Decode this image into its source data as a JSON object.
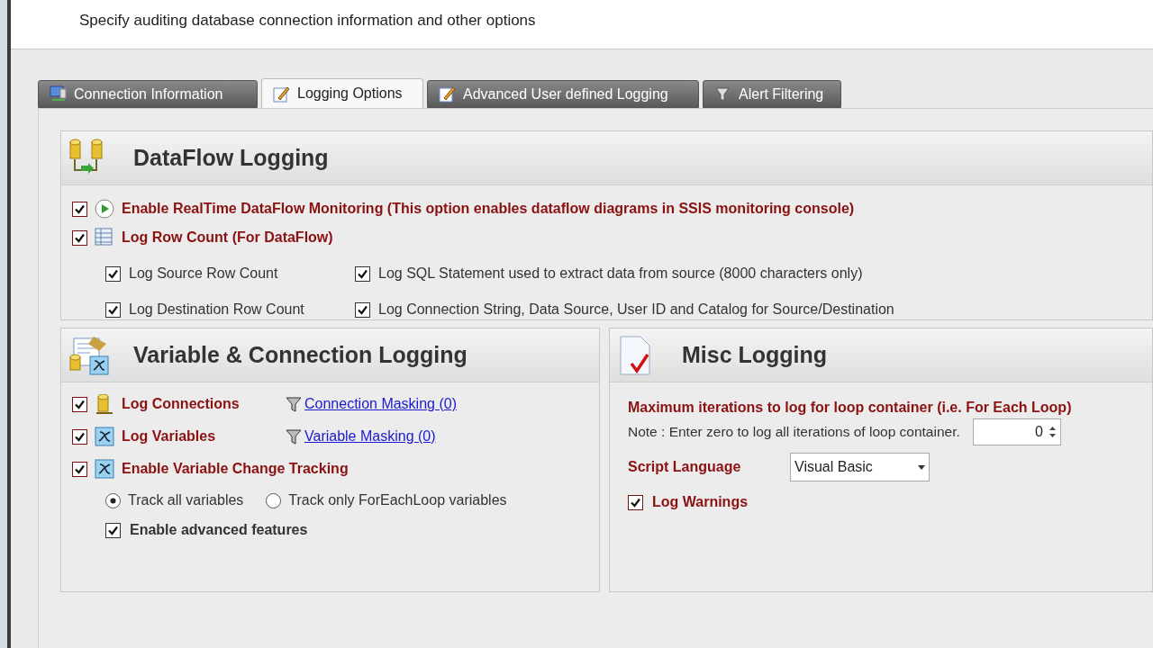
{
  "header": {
    "subtitle": "Specify auditing database connection information and other options"
  },
  "tabs": [
    {
      "label": "Connection Information",
      "selected": false
    },
    {
      "label": "Logging Options",
      "selected": true
    },
    {
      "label": "Advanced User defined Logging",
      "selected": false
    },
    {
      "label": "Alert Filtering",
      "selected": false
    }
  ],
  "dataflow": {
    "title": "DataFlow Logging",
    "options": [
      {
        "label": "Enable RealTime DataFlow Monitoring (This option enables dataflow diagrams in SSIS monitoring console)",
        "checked": true
      },
      {
        "label": "Log Row Count (For DataFlow)",
        "checked": true
      }
    ],
    "sub_options": [
      {
        "label": "Log Source Row Count",
        "checked": true
      },
      {
        "label": "Log SQL Statement used to extract data from source (8000 characters only)",
        "checked": true
      },
      {
        "label": "Log Destination Row Count",
        "checked": true
      },
      {
        "label": "Log Connection String, Data Source, User ID and Catalog for Source/Destination",
        "checked": true
      }
    ]
  },
  "variable": {
    "title": "Variable & Connection Logging",
    "options": [
      {
        "label": "Log Connections",
        "checked": true,
        "link": "Connection Masking (0)"
      },
      {
        "label": "Log Variables",
        "checked": true,
        "link": "Variable Masking (0)"
      },
      {
        "label": "Enable Variable Change Tracking",
        "checked": true
      }
    ],
    "radios": [
      {
        "label": "Track all variables",
        "selected": true
      },
      {
        "label": "Track only ForEachLoop variables",
        "selected": false
      }
    ],
    "advanced": {
      "label": "Enable advanced features",
      "checked": true
    }
  },
  "misc": {
    "title": "Misc Logging",
    "max_label": "Maximum iterations to log for loop container (i.e. For Each Loop)",
    "note": "Note : Enter zero to log all iterations of loop container.",
    "iterations": "0",
    "script_language": {
      "label": "Script Language",
      "value": "Visual Basic"
    },
    "log_warnings": {
      "label": "Log Warnings",
      "checked": true
    }
  }
}
